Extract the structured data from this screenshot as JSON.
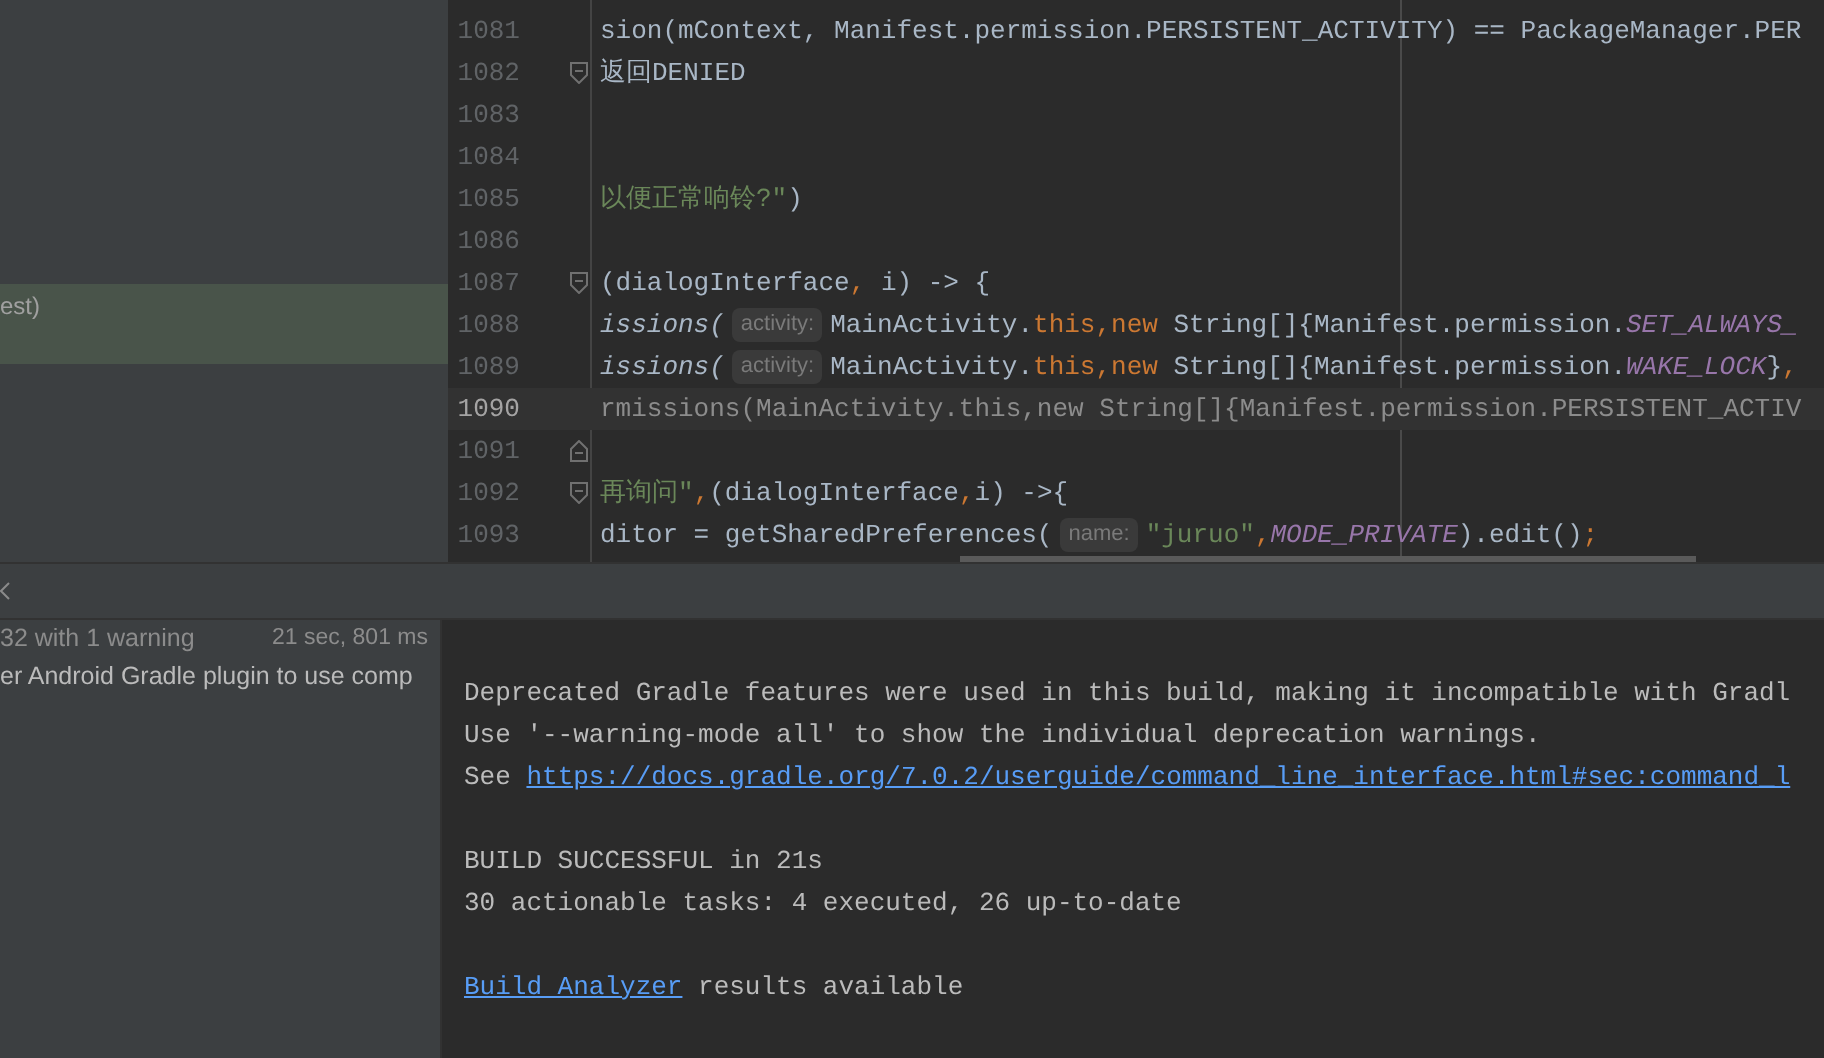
{
  "project_panel": {
    "rows": [
      {
        "text": "est)",
        "selected": true
      }
    ]
  },
  "editor": {
    "lines": [
      {
        "number": "1081",
        "current": false,
        "fold_open": false,
        "fold_close": false,
        "tokens": [
          {
            "kind": "plain",
            "text": "sion(mContext, Manifest.permission.PERSISTENT_ACTIVITY) == PackageManager.PER"
          }
        ]
      },
      {
        "number": "1082",
        "current": false,
        "fold_open": true,
        "fold_close": false,
        "tokens": [
          {
            "kind": "plain",
            "text": "返回DENIED"
          }
        ]
      },
      {
        "number": "1083",
        "current": false,
        "fold_open": false,
        "fold_close": false
      },
      {
        "number": "1084",
        "current": false,
        "fold_open": false,
        "fold_close": false
      },
      {
        "number": "1085",
        "current": false,
        "fold_open": false,
        "fold_close": false,
        "tokens": [
          {
            "kind": "string",
            "text": "以便正常响铃?\""
          },
          {
            "kind": "plain",
            "text": ")"
          }
        ]
      },
      {
        "number": "1086",
        "current": false,
        "fold_open": false,
        "fold_close": false
      },
      {
        "number": "1087",
        "current": false,
        "fold_open": true,
        "fold_close": false,
        "tokens": [
          {
            "kind": "plain",
            "text": "(dialogInterface"
          },
          {
            "kind": "keyword",
            "text": ","
          },
          {
            "kind": "plain",
            "text": " i) -> {"
          }
        ]
      },
      {
        "number": "1088",
        "current": false,
        "fold_open": false,
        "fold_close": false,
        "tokens": [
          {
            "kind": "method",
            "text": "issions("
          },
          {
            "kind": "hint",
            "text": "activity:"
          },
          {
            "kind": "plain",
            "text": "MainActivity."
          },
          {
            "kind": "keyword",
            "text": "this,new"
          },
          {
            "kind": "plain",
            "text": " String[]{Manifest.permission."
          },
          {
            "kind": "constant",
            "text": "SET_ALWAYS_"
          }
        ]
      },
      {
        "number": "1089",
        "current": false,
        "fold_open": false,
        "fold_close": false,
        "tokens": [
          {
            "kind": "method",
            "text": "issions("
          },
          {
            "kind": "hint",
            "text": "activity:"
          },
          {
            "kind": "plain",
            "text": "MainActivity."
          },
          {
            "kind": "keyword",
            "text": "this,new"
          },
          {
            "kind": "plain",
            "text": " String[]{Manifest.permission."
          },
          {
            "kind": "constant",
            "text": "WAKE_LOCK"
          },
          {
            "kind": "plain",
            "text": "}"
          },
          {
            "kind": "keyword",
            "text": ","
          }
        ]
      },
      {
        "number": "1090",
        "current": true,
        "fold_open": false,
        "fold_close": false,
        "tokens": [
          {
            "kind": "dim",
            "text": "rmissions(MainActivity.this,new String[]{Manifest.permission.PERSISTENT_ACTIV"
          }
        ]
      },
      {
        "number": "1091",
        "current": false,
        "fold_open": false,
        "fold_close": true
      },
      {
        "number": "1092",
        "current": false,
        "fold_open": true,
        "fold_close": false,
        "tokens": [
          {
            "kind": "string",
            "text": "再询问\""
          },
          {
            "kind": "keyword",
            "text": ","
          },
          {
            "kind": "plain",
            "text": "(dialogInterface"
          },
          {
            "kind": "keyword",
            "text": ","
          },
          {
            "kind": "plain",
            "text": "i) ->{"
          }
        ]
      },
      {
        "number": "1093",
        "current": false,
        "fold_open": false,
        "fold_close": false,
        "tokens": [
          {
            "kind": "plain",
            "text": "ditor = getSharedPreferences("
          },
          {
            "kind": "hint",
            "text": "name:"
          },
          {
            "kind": "string",
            "text": "\"juruo\""
          },
          {
            "kind": "keyword",
            "text": ","
          },
          {
            "kind": "constant",
            "text": "MODE_PRIVATE"
          },
          {
            "kind": "plain",
            "text": ").edit()"
          },
          {
            "kind": "keyword",
            "text": ";"
          }
        ]
      }
    ]
  },
  "build_panel": {
    "tree": [
      {
        "text": "32 with 1 warning",
        "time": "21 sec, 801 ms",
        "kind": "summary"
      },
      {
        "text": "er Android Gradle plugin to use comp",
        "kind": "message"
      }
    ],
    "output": [
      {
        "kind": "text",
        "segments": [
          {
            "text": "Deprecated Gradle features were used in this build, making it incompatible with Gradl",
            "link": false
          }
        ]
      },
      {
        "kind": "text",
        "segments": [
          {
            "text": "Use '--warning-mode all' to show the individual deprecation warnings.",
            "link": false
          }
        ]
      },
      {
        "kind": "text",
        "segments": [
          {
            "text": "See ",
            "link": false
          },
          {
            "text": "https://docs.gradle.org/7.0.2/userguide/command_line_interface.html#sec:command_l",
            "link": true
          }
        ]
      },
      {
        "kind": "blank"
      },
      {
        "kind": "text",
        "segments": [
          {
            "text": "BUILD SUCCESSFUL in 21s",
            "link": false
          }
        ]
      },
      {
        "kind": "text",
        "segments": [
          {
            "text": "30 actionable tasks: 4 executed, 26 up-to-date",
            "link": false
          }
        ]
      },
      {
        "kind": "blank"
      },
      {
        "kind": "text",
        "segments": [
          {
            "text": "Build Analyzer",
            "link": true
          },
          {
            "text": " results available",
            "link": false
          }
        ]
      }
    ]
  }
}
